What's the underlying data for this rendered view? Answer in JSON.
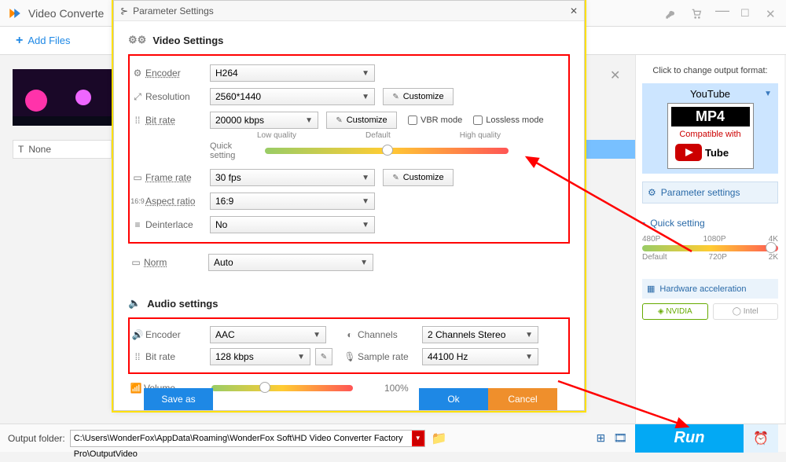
{
  "header": {
    "title": "Video Converte"
  },
  "toolbar": {
    "add_files": "Add Files"
  },
  "left": {
    "none": "None"
  },
  "right": {
    "click_title": "Click to change output format:",
    "format": "YouTube",
    "badge_codec": "MP4",
    "badge_compat": "Compatible with",
    "param_btn": "Parameter settings",
    "quick": "Quick setting",
    "qs_top": [
      "480P",
      "1080P",
      "4K"
    ],
    "qs_bot": [
      "Default",
      "720P",
      "2K"
    ],
    "hw": "Hardware acceleration",
    "nvidia": "NVIDIA",
    "intel": "Intel"
  },
  "modal": {
    "title": "Parameter Settings",
    "video_hd": "Video Settings",
    "audio_hd": "Audio settings",
    "rows": {
      "encoder_lbl": "Encoder",
      "encoder_val": "H264",
      "resolution_lbl": "Resolution",
      "resolution_val": "2560*1440",
      "bitrate_lbl": "Bit rate",
      "bitrate_val": "20000 kbps",
      "vbr": "VBR mode",
      "lossless": "Lossless mode",
      "quick_lbl": "Quick setting",
      "ql_low": "Low quality",
      "ql_def": "Default",
      "ql_high": "High quality",
      "fps_lbl": "Frame rate",
      "fps_val": "30 fps",
      "aspect_lbl": "Aspect ratio",
      "aspect_val": "16:9",
      "deint_lbl": "Deinterlace",
      "deint_val": "No",
      "norm_lbl": "Norm",
      "norm_val": "Auto",
      "cust": "Customize"
    },
    "audio": {
      "encoder_lbl": "Encoder",
      "encoder_val": "AAC",
      "channels_lbl": "Channels",
      "channels_val": "2 Channels Stereo",
      "bitrate_lbl": "Bit rate",
      "bitrate_val": "128 kbps",
      "sample_lbl": "Sample rate",
      "sample_val": "44100 Hz",
      "volume_lbl": "Volume",
      "volume_pct": "100%"
    },
    "footer": {
      "save": "Save as",
      "ok": "Ok",
      "cancel": "Cancel"
    }
  },
  "bottom": {
    "label": "Output folder:",
    "path": "C:\\Users\\WonderFox\\AppData\\Roaming\\WonderFox Soft\\HD Video Converter Factory Pro\\OutputVideo",
    "run": "Run"
  }
}
